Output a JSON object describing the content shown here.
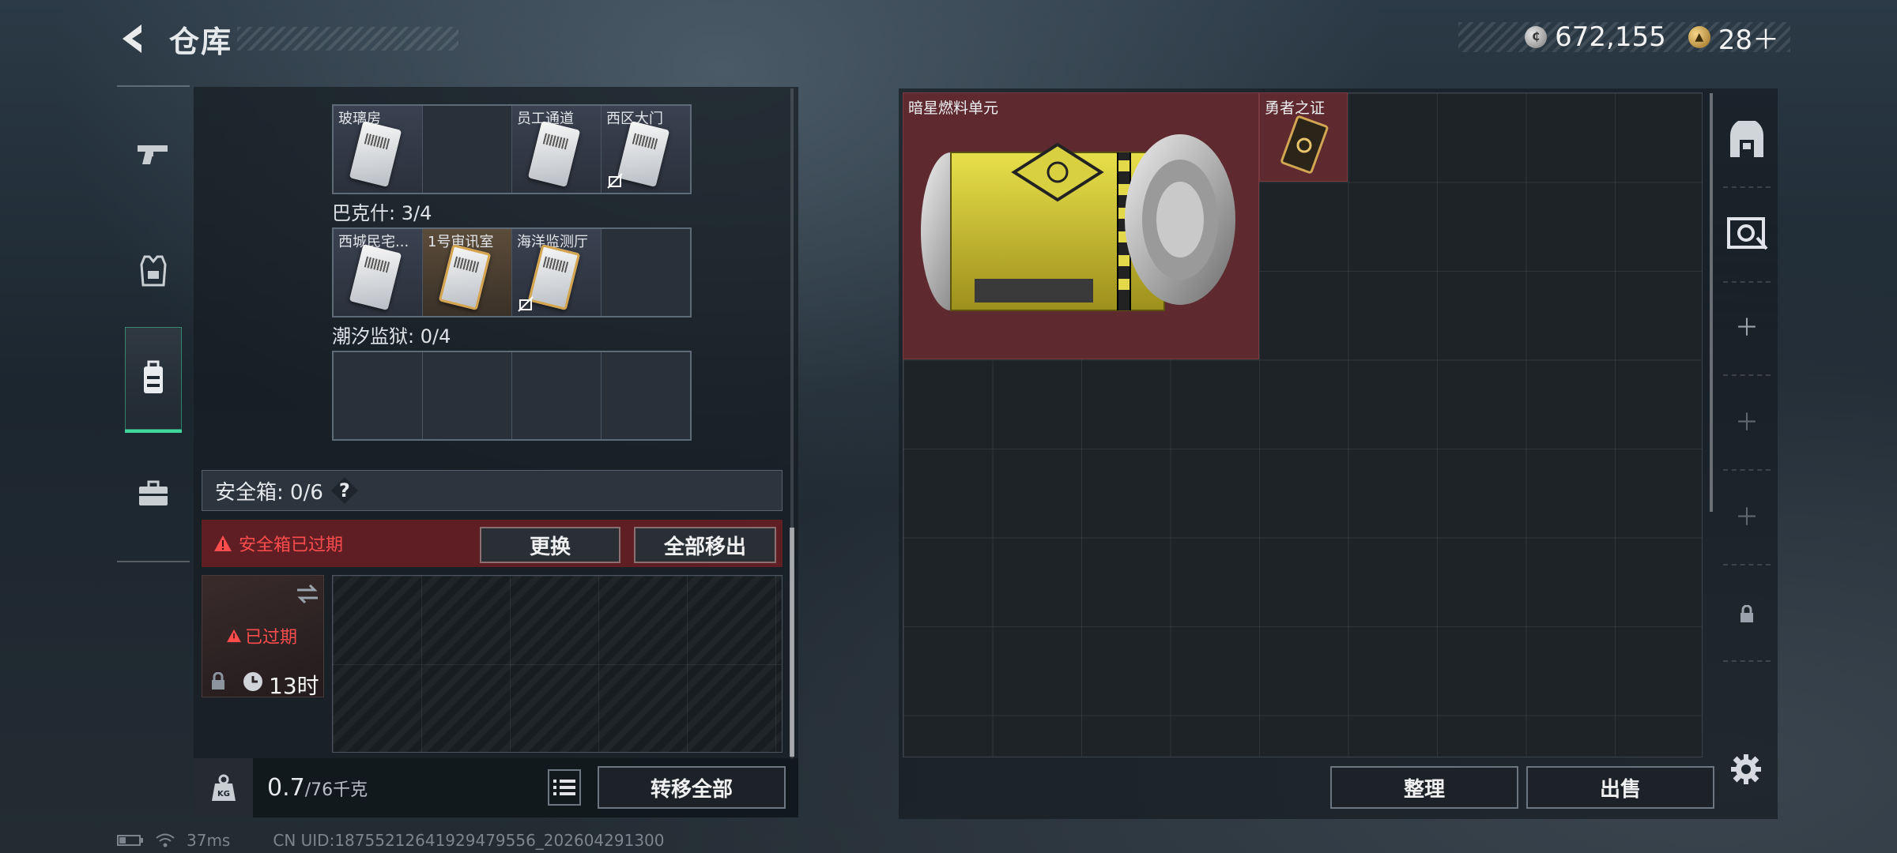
{
  "header": {
    "title": "仓库",
    "silver_value": "672,155",
    "gold_value": "28＋"
  },
  "key_groups": [
    {
      "label": "",
      "cells": [
        {
          "name": "玻璃房",
          "filled": true,
          "broken": false
        },
        {
          "name": "",
          "filled": false,
          "broken": false
        },
        {
          "name": "员工通道",
          "filled": true,
          "broken": false
        },
        {
          "name": "西区大门",
          "filled": true,
          "broken": true
        }
      ]
    },
    {
      "label": "巴克什: 3/4",
      "cells": [
        {
          "name": "西城民宅...",
          "filled": true,
          "broken": false
        },
        {
          "name": "1号审讯室",
          "filled": true,
          "orange": true,
          "broken": false
        },
        {
          "name": "海洋监测厅",
          "filled": true,
          "broken": true
        },
        {
          "name": "",
          "filled": false,
          "broken": false
        }
      ]
    },
    {
      "label": "潮汐监狱: 0/4",
      "cells": [
        {
          "name": "",
          "filled": false
        },
        {
          "name": "",
          "filled": false
        },
        {
          "name": "",
          "filled": false
        },
        {
          "name": "",
          "filled": false
        }
      ]
    }
  ],
  "safe_box": {
    "title": "安全箱: 0/6",
    "help": "?",
    "expired_notice": "安全箱已过期",
    "replace_label": "更换",
    "remove_all_label": "全部移出",
    "status": "已过期",
    "timer": "13时"
  },
  "footer_left": {
    "weight_current": "0.7",
    "weight_max": "/76千克",
    "transfer_all_label": "转移全部"
  },
  "stash": {
    "items": [
      {
        "name": "暗星燃料单元"
      },
      {
        "name": "勇者之证"
      }
    ],
    "sort_label": "整理",
    "sell_label": "出售"
  },
  "status_bar": {
    "ping": "37ms",
    "uid": "CN UID:18755212641929479556_202604291300"
  },
  "colors": {
    "accent_green": "#3fd6a0",
    "item_red": "#5e2a30",
    "warning_red": "#ff4d4d"
  }
}
